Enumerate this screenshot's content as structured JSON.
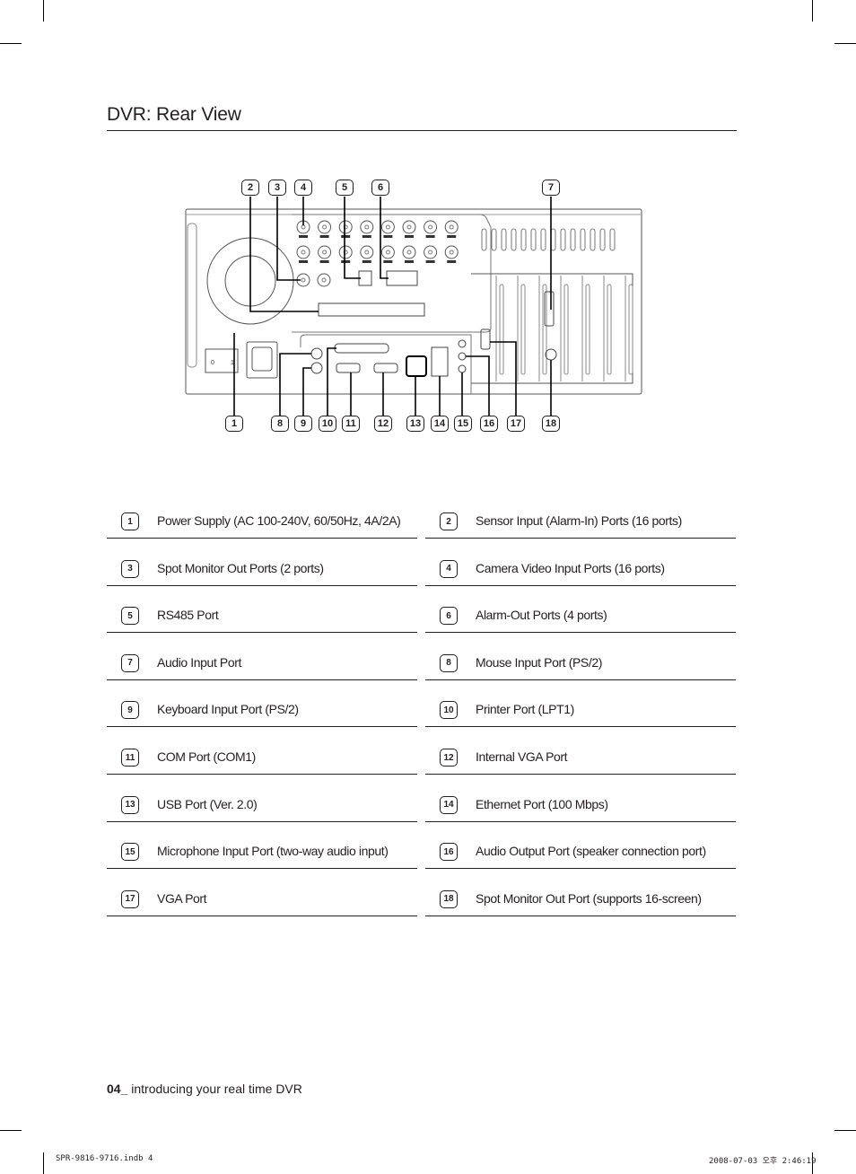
{
  "page": {
    "title": "DVR: Rear View",
    "page_number": "04_",
    "footer_text": " introducing your real time DVR",
    "slug_left": "SPR-9816-9716.indb   4",
    "slug_right": "2008-07-03   오후 2:46:19"
  },
  "diagram": {
    "top_callouts": [
      "2",
      "3",
      "4",
      "5",
      "6",
      "7"
    ],
    "bottom_callouts": [
      "1",
      "8",
      "9",
      "10",
      "11",
      "12",
      "13",
      "14",
      "15",
      "16",
      "17",
      "18"
    ],
    "switch_labels": {
      "off": "0",
      "on": "1"
    }
  },
  "legend": [
    {
      "num": "1",
      "label": "Power Supply (AC 100-240V, 60/50Hz, 4A/2A)"
    },
    {
      "num": "2",
      "label": "Sensor Input (Alarm-In) Ports (16 ports)"
    },
    {
      "num": "3",
      "label": "Spot Monitor Out Ports (2 ports)"
    },
    {
      "num": "4",
      "label": "Camera Video Input Ports (16 ports)"
    },
    {
      "num": "5",
      "label": "RS485 Port"
    },
    {
      "num": "6",
      "label": "Alarm-Out Ports (4 ports)"
    },
    {
      "num": "7",
      "label": "Audio Input Port"
    },
    {
      "num": "8",
      "label": "Mouse Input Port (PS/2)"
    },
    {
      "num": "9",
      "label": "Keyboard Input Port (PS/2)"
    },
    {
      "num": "10",
      "label": "Printer Port (LPT1)"
    },
    {
      "num": "11",
      "label": "COM Port (COM1)"
    },
    {
      "num": "12",
      "label": "Internal VGA Port"
    },
    {
      "num": "13",
      "label": "USB Port (Ver. 2.0)"
    },
    {
      "num": "14",
      "label": "Ethernet Port (100 Mbps)"
    },
    {
      "num": "15",
      "label": "Microphone Input Port (two-way audio input)"
    },
    {
      "num": "16",
      "label": "Audio Output Port (speaker connection port)"
    },
    {
      "num": "17",
      "label": "VGA Port"
    },
    {
      "num": "18",
      "label": "Spot Monitor Out Port (supports 16-screen)"
    }
  ]
}
